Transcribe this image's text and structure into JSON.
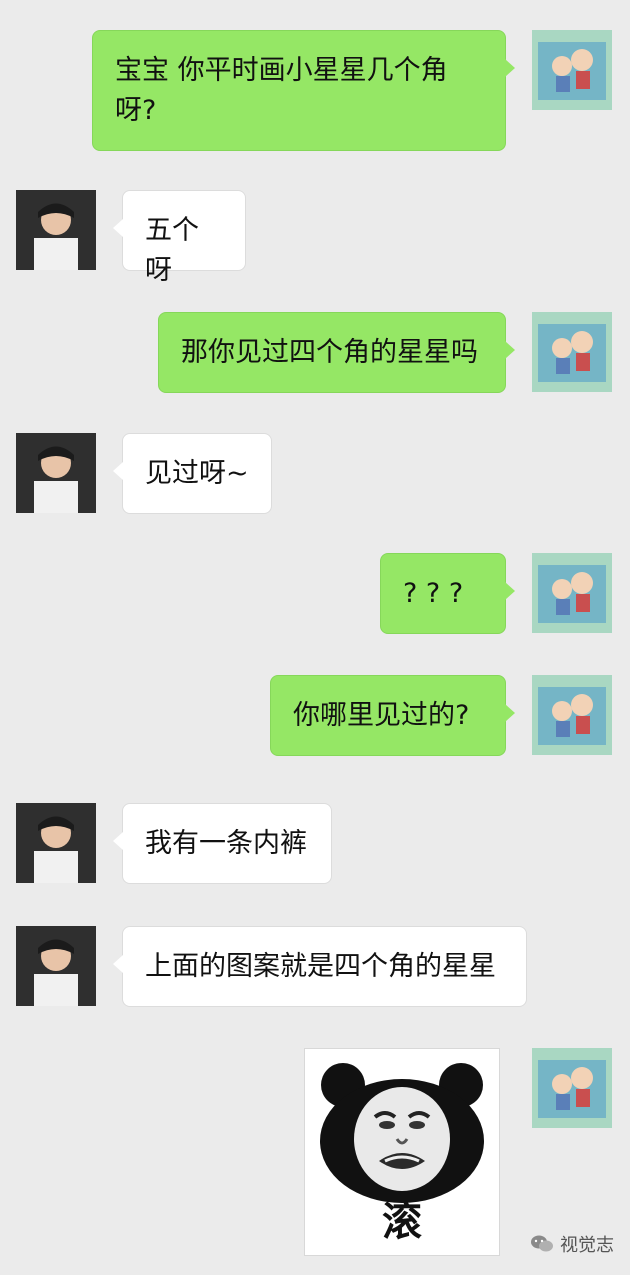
{
  "messages": [
    {
      "side": "right",
      "text": "宝宝 你平时画小星星几个角\n呀?"
    },
    {
      "side": "left",
      "text": "五个呀"
    },
    {
      "side": "right",
      "text": "那你见过四个角的星星吗"
    },
    {
      "side": "left",
      "text": "见过呀~"
    },
    {
      "side": "right",
      "text": "? ? ?"
    },
    {
      "side": "right",
      "text": "你哪里见过的?"
    },
    {
      "side": "left",
      "text": "我有一条内裤"
    },
    {
      "side": "left",
      "text": "上面的图案就是四个角的星星"
    }
  ],
  "sticker": {
    "caption": "滚"
  },
  "watermark": {
    "text": "视觉志"
  }
}
